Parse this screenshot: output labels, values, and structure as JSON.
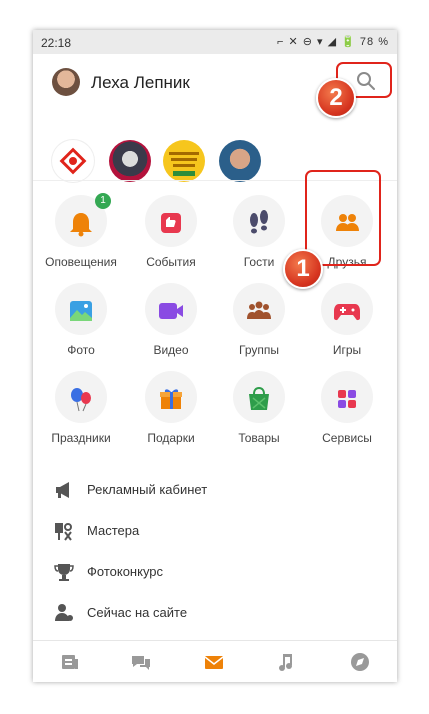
{
  "status_bar": {
    "time": "22:18",
    "icons": "⌐ ✕ ⊖ ▾ ◢ 🔋",
    "battery": "78 %"
  },
  "profile": {
    "name": "Леха Лепник",
    "avatar_icon": "user-photo"
  },
  "stories": [
    {
      "icon": "red-logo-story"
    },
    {
      "icon": "einstein-story"
    },
    {
      "icon": "yellow-text-story"
    },
    {
      "icon": "man-story"
    }
  ],
  "grid": [
    {
      "label": "Оповещения",
      "icon": "bell-icon",
      "badge": "1"
    },
    {
      "label": "События",
      "icon": "thumbs-up-icon"
    },
    {
      "label": "Гости",
      "icon": "footprints-icon"
    },
    {
      "label": "Друзья",
      "icon": "friends-icon"
    },
    {
      "label": "Фото",
      "icon": "photo-icon"
    },
    {
      "label": "Видео",
      "icon": "video-icon"
    },
    {
      "label": "Группы",
      "icon": "groups-icon"
    },
    {
      "label": "Игры",
      "icon": "gamepad-icon"
    },
    {
      "label": "Праздники",
      "icon": "balloons-icon"
    },
    {
      "label": "Подарки",
      "icon": "gift-icon"
    },
    {
      "label": "Товары",
      "icon": "shopping-bag-icon"
    },
    {
      "label": "Сервисы",
      "icon": "services-icon"
    }
  ],
  "menu": [
    {
      "label": "Рекламный кабинет",
      "icon": "megaphone-icon"
    },
    {
      "label": "Мастера",
      "icon": "tools-icon"
    },
    {
      "label": "Фотоконкурс",
      "icon": "trophy-icon"
    },
    {
      "label": "Сейчас на сайте",
      "icon": "person-online-icon"
    }
  ],
  "annotations": {
    "first": "1",
    "second": "2"
  },
  "colors": {
    "accent_orange": "#ee8208",
    "annotation_red": "#e0241b",
    "badge_green": "#34a853"
  }
}
